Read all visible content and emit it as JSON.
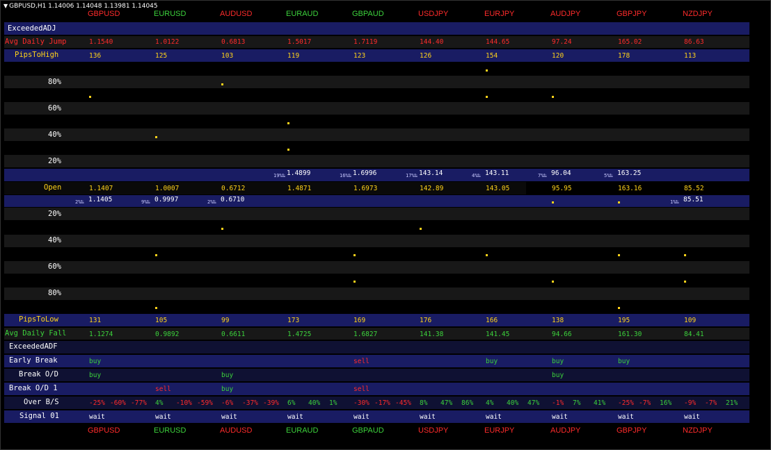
{
  "header": {
    "symbol_info": "GBPUSD,H1  1.14006 1.14048 1.13981 1.14045"
  },
  "symbols": [
    {
      "name": "GBPUSD",
      "color": "red"
    },
    {
      "name": "EURUSD",
      "color": "green"
    },
    {
      "name": "AUDUSD",
      "color": "red"
    },
    {
      "name": "EURAUD",
      "color": "green"
    },
    {
      "name": "GBPAUD",
      "color": "green"
    },
    {
      "name": "USDJPY",
      "color": "red"
    },
    {
      "name": "EURJPY",
      "color": "red"
    },
    {
      "name": "AUDJPY",
      "color": "red"
    },
    {
      "name": "GBPJPY",
      "color": "red"
    },
    {
      "name": "NZDJPY",
      "color": "red"
    }
  ],
  "labels": {
    "exceeded_adj": "ExceededADJ",
    "avg_daily_jump": "Avg Daily Jump",
    "pips_to_high": "PipsToHigh",
    "open": "Open",
    "pips_to_low": "PipsToLow",
    "avg_daily_fall": "Avg Daily Fall",
    "exceeded_adf": "ExceededADF",
    "early_break": "Early Break",
    "break_od": "Break O/D",
    "break_od1": "Break O/D 1",
    "over_bs": "Over B/S",
    "signal01": "Signal 01"
  },
  "pct_levels_upper": [
    "80%",
    "60%",
    "40%",
    "20%"
  ],
  "pct_levels_lower": [
    "20%",
    "40%",
    "60%",
    "80%"
  ],
  "avg_daily_jump": [
    "1.1540",
    "1.0122",
    "0.6813",
    "1.5017",
    "1.7119",
    "144.40",
    "144.65",
    "97.24",
    "165.02",
    "86.63"
  ],
  "pips_to_high": [
    "136",
    "125",
    "103",
    "119",
    "123",
    "126",
    "154",
    "120",
    "178",
    "113"
  ],
  "high_marks": [
    {
      "col": 3,
      "pct": "19%",
      "val": "1.4899"
    },
    {
      "col": 4,
      "pct": "16%",
      "val": "1.6996"
    },
    {
      "col": 5,
      "pct": "17%",
      "val": "143.14"
    },
    {
      "col": 6,
      "pct": "4%",
      "val": "143.11"
    },
    {
      "col": 7,
      "pct": "7%",
      "val": "96.04"
    },
    {
      "col": 8,
      "pct": "5%",
      "val": "163.25"
    }
  ],
  "open": [
    "1.1407",
    "1.0007",
    "0.6712",
    "1.4871",
    "1.6973",
    "142.89",
    "143.05",
    "95.95",
    "163.16",
    "85.52"
  ],
  "low_marks": [
    {
      "col": 0,
      "pct": "2%",
      "val": "1.1405"
    },
    {
      "col": 1,
      "pct": "9%",
      "val": "0.9997"
    },
    {
      "col": 2,
      "pct": "2%",
      "val": "0.6710"
    },
    {
      "col": 9,
      "pct": "1%",
      "val": "85.51"
    }
  ],
  "pips_to_low": [
    "131",
    "105",
    "99",
    "173",
    "169",
    "176",
    "166",
    "138",
    "195",
    "109"
  ],
  "avg_daily_fall": [
    "1.1274",
    "0.9892",
    "0.6611",
    "1.4725",
    "1.6827",
    "141.38",
    "141.45",
    "94.66",
    "161.30",
    "84.41"
  ],
  "early_break": [
    "buy",
    "",
    "",
    "",
    "sell",
    "",
    "buy",
    "buy",
    "buy",
    ""
  ],
  "break_od": [
    "buy",
    "",
    "buy",
    "",
    "",
    "",
    "",
    "buy",
    "",
    ""
  ],
  "break_od1": [
    "",
    "sell",
    "buy",
    "",
    "sell",
    "",
    "",
    "",
    "",
    ""
  ],
  "over_bs": [
    [
      {
        "t": "-25%",
        "c": "red"
      },
      {
        "t": "-60%",
        "c": "red"
      },
      {
        "t": "-77%",
        "c": "red"
      }
    ],
    [
      {
        "t": "4%",
        "c": "green"
      },
      {
        "t": "-10%",
        "c": "red"
      },
      {
        "t": "-59%",
        "c": "red"
      }
    ],
    [
      {
        "t": "-6%",
        "c": "red"
      },
      {
        "t": "-37%",
        "c": "red"
      },
      {
        "t": "-39%",
        "c": "red"
      }
    ],
    [
      {
        "t": "6%",
        "c": "green"
      },
      {
        "t": "40%",
        "c": "green"
      },
      {
        "t": "1%",
        "c": "green"
      }
    ],
    [
      {
        "t": "-30%",
        "c": "red"
      },
      {
        "t": "-17%",
        "c": "red"
      },
      {
        "t": "-45%",
        "c": "red"
      }
    ],
    [
      {
        "t": "8%",
        "c": "green"
      },
      {
        "t": "47%",
        "c": "green"
      },
      {
        "t": "86%",
        "c": "green"
      }
    ],
    [
      {
        "t": "4%",
        "c": "green"
      },
      {
        "t": "40%",
        "c": "green"
      },
      {
        "t": "47%",
        "c": "green"
      }
    ],
    [
      {
        "t": "-1%",
        "c": "red"
      },
      {
        "t": "7%",
        "c": "green"
      },
      {
        "t": "41%",
        "c": "green"
      }
    ],
    [
      {
        "t": "-25%",
        "c": "red"
      },
      {
        "t": "-7%",
        "c": "red"
      },
      {
        "t": "16%",
        "c": "green"
      }
    ],
    [
      {
        "t": "-9%",
        "c": "red"
      },
      {
        "t": "-7%",
        "c": "red"
      },
      {
        "t": "21%",
        "c": "green"
      }
    ]
  ],
  "signal01": [
    "wait",
    "wait",
    "wait",
    "wait",
    "wait",
    "wait",
    "wait",
    "wait",
    "wait",
    "wait"
  ],
  "colors": {
    "red": "#ff2b2b",
    "green": "#3cd23c",
    "yellow": "#ffd21a",
    "navy": "#191c63",
    "dark_navy": "#0f1133"
  }
}
